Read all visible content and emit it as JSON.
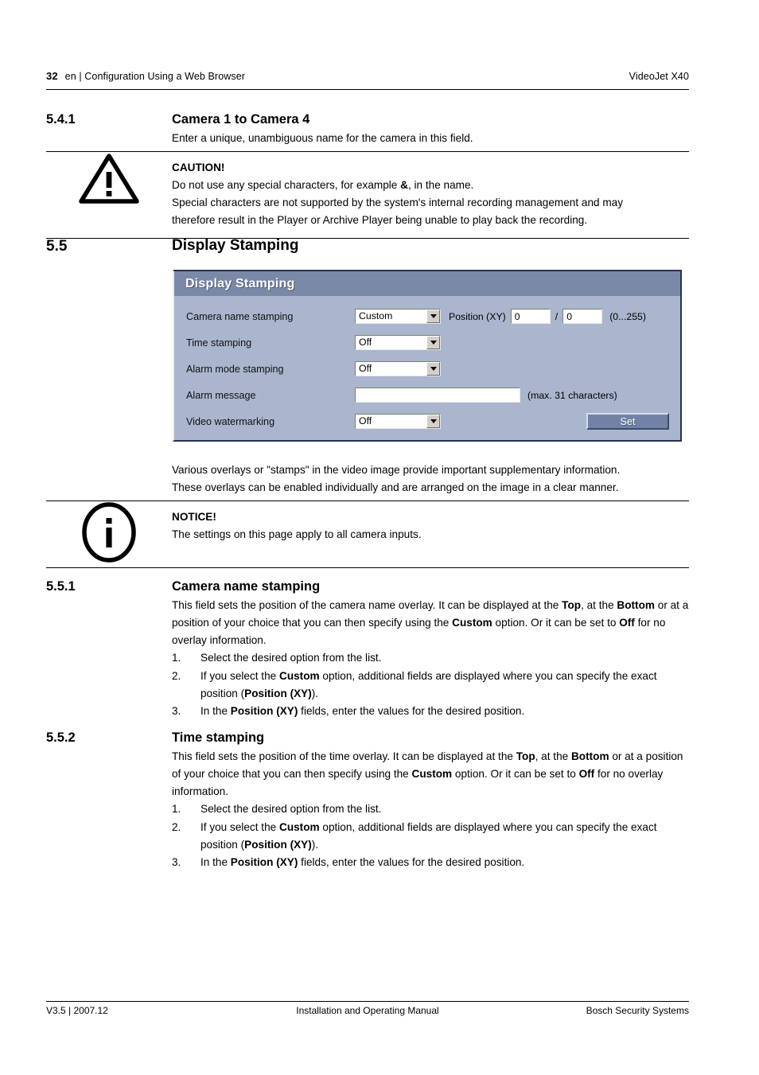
{
  "header": {
    "page_number": "32",
    "section_path": "en | Configuration Using a Web Browser",
    "product": "VideoJet X40"
  },
  "sections": {
    "s541": {
      "number": "5.4.1",
      "title": "Camera 1 to Camera 4",
      "body": "Enter a unique, unambiguous name for the camera in this field."
    },
    "caution": {
      "icon": "warning-triangle-icon",
      "title": "CAUTION!",
      "line1_pre": "Do not use any special characters, for example ",
      "line1_bold": "&",
      "line1_post": ", in the name.",
      "line2": "Special characters are not supported by the system's internal recording management and may",
      "line3": "therefore result in the Player or Archive Player being unable to play back the recording."
    },
    "s55": {
      "number": "5.5",
      "title": "Display Stamping",
      "para1": "Various overlays or \"stamps\" in the video image provide important supplementary information.",
      "para2": "These overlays can be enabled individually and are arranged on the image in a clear manner."
    },
    "notice": {
      "icon": "info-circle-icon",
      "title": "NOTICE!",
      "body": "The settings on this page apply to all camera inputs."
    },
    "s551": {
      "number": "5.5.1",
      "title": "Camera name stamping",
      "para_parts": [
        {
          "t": "This field sets the position of the camera name overlay. It can be displayed at the ",
          "b": false
        },
        {
          "t": "Top",
          "b": true
        },
        {
          "t": ", at the ",
          "b": false
        },
        {
          "t": "Bottom",
          "b": true
        },
        {
          "t": " or at a position of your choice that you can then specify using the ",
          "b": false
        },
        {
          "t": "Custom",
          "b": true
        },
        {
          "t": " option. Or it can be set to ",
          "b": false
        },
        {
          "t": "Off",
          "b": true
        },
        {
          "t": " for no overlay information.",
          "b": false
        }
      ],
      "steps": [
        {
          "marker": "1.",
          "parts": [
            {
              "t": "Select the desired option from the list.",
              "b": false
            }
          ]
        },
        {
          "marker": "2.",
          "parts": [
            {
              "t": "If you select the ",
              "b": false
            },
            {
              "t": "Custom",
              "b": true
            },
            {
              "t": " option, additional fields are displayed where you can specify the exact position (",
              "b": false
            },
            {
              "t": "Position (XY)",
              "b": true
            },
            {
              "t": ").",
              "b": false
            }
          ]
        },
        {
          "marker": "3.",
          "parts": [
            {
              "t": "In the ",
              "b": false
            },
            {
              "t": "Position (XY)",
              "b": true
            },
            {
              "t": " fields, enter the values for the desired position.",
              "b": false
            }
          ]
        }
      ]
    },
    "s552": {
      "number": "5.5.2",
      "title": "Time stamping",
      "para_parts": [
        {
          "t": "This field sets the position of the time overlay. It can be displayed at the ",
          "b": false
        },
        {
          "t": "Top",
          "b": true
        },
        {
          "t": ", at the ",
          "b": false
        },
        {
          "t": "Bottom",
          "b": true
        },
        {
          "t": " or at a position of your choice that you can then specify using the ",
          "b": false
        },
        {
          "t": "Custom",
          "b": true
        },
        {
          "t": " option. Or it can be set to ",
          "b": false
        },
        {
          "t": "Off",
          "b": true
        },
        {
          "t": " for no overlay information.",
          "b": false
        }
      ],
      "steps": [
        {
          "marker": "1.",
          "parts": [
            {
              "t": "Select the desired option from the list.",
              "b": false
            }
          ]
        },
        {
          "marker": "2.",
          "parts": [
            {
              "t": "If you select the ",
              "b": false
            },
            {
              "t": "Custom",
              "b": true
            },
            {
              "t": " option, additional fields are displayed where you can specify the exact position (",
              "b": false
            },
            {
              "t": "Position (XY)",
              "b": true
            },
            {
              "t": ").",
              "b": false
            }
          ]
        },
        {
          "marker": "3.",
          "parts": [
            {
              "t": "In the ",
              "b": false
            },
            {
              "t": "Position (XY)",
              "b": true
            },
            {
              "t": " fields, enter the values for the desired position.",
              "b": false
            }
          ]
        }
      ]
    }
  },
  "screenshot_panel": {
    "title": "Display Stamping",
    "colors": {
      "title_bar": "#7b89a8",
      "body": "#a9b6ce",
      "button": "#7182a5",
      "frame_dark": "#28334d",
      "field_bg": "#ffffff",
      "arrow_button": "#d4d0c8"
    },
    "rows": [
      {
        "label": "Camera name stamping",
        "select_value": "Custom",
        "position_label": "Position (XY)",
        "position_x": "0",
        "position_separator": "/",
        "position_y": "0",
        "range_hint": "(0...255)"
      },
      {
        "label": "Time stamping",
        "select_value": "Off"
      },
      {
        "label": "Alarm mode stamping",
        "select_value": "Off"
      },
      {
        "label": "Alarm message",
        "input_value": "",
        "input_placeholder": "",
        "hint": "(max. 31 characters)"
      },
      {
        "label": "Video watermarking",
        "select_value": "Off",
        "button_label": "Set"
      }
    ]
  },
  "footer": {
    "version": "V3.5 | 2007.12",
    "title": "Installation and Operating Manual",
    "company": "Bosch Security Systems"
  }
}
